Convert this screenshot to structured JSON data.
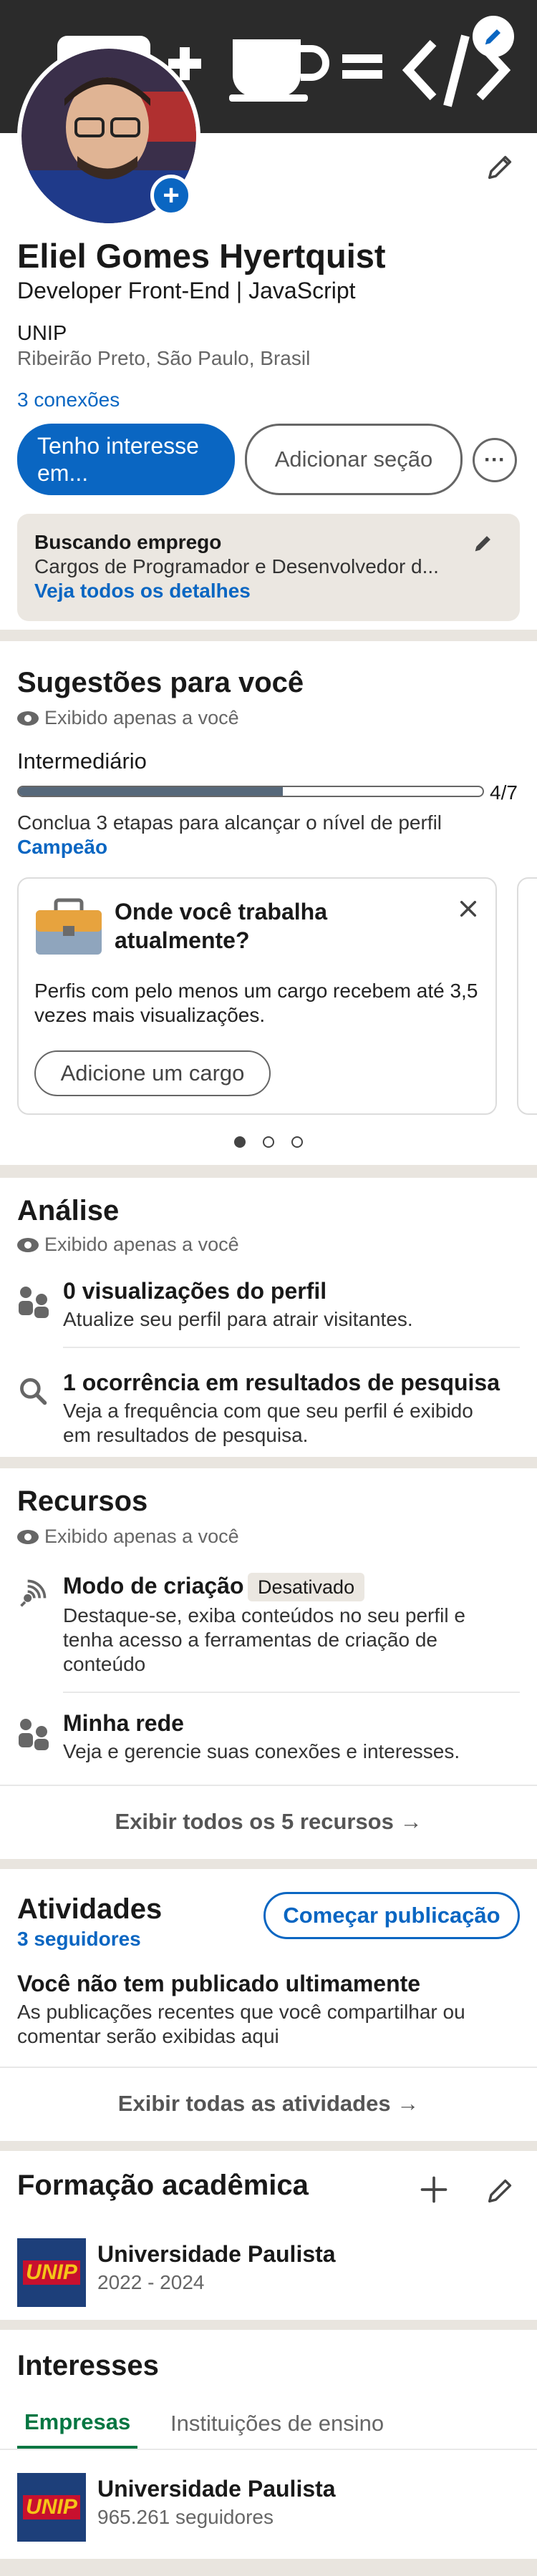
{
  "header": {
    "banner_glyphs": "☕ = </>",
    "add_photo_label": "+"
  },
  "profile": {
    "name": "Eliel Gomes Hyertquist",
    "headline": "Developer Front-End | JavaScript",
    "school": "UNIP",
    "location": "Ribeirão Preto, São Paulo, Brasil",
    "connections": "3 conexões",
    "primary_button": "Tenho interesse em...",
    "secondary_button": "Adicionar seção",
    "more_button": "···"
  },
  "open_to_work": {
    "title": "Buscando emprego",
    "description": "Cargos de Programador e Desenvolvedor d...",
    "link": "Veja todos os detalhes"
  },
  "suggestions": {
    "title": "Sugestões para você",
    "private_label": "Exibido apenas a você",
    "level": "Intermediário",
    "progress_text": "4/7",
    "progress_fraction": 0.57,
    "hint": "Conclua 3 etapas para alcançar o nível de perfil",
    "target_level": "Campeão",
    "card_title": "Onde você trabalha atualmente?",
    "card_text": "Perfis com pelo menos um cargo recebem até 3,5 vezes mais visualizações.",
    "card_button": "Adicione um cargo",
    "dots_total": 3,
    "dots_active": 0
  },
  "analytics": {
    "title": "Análise",
    "private_label": "Exibido apenas a você",
    "items": [
      {
        "title": "0 visualizações do perfil",
        "subtitle": "Atualize seu perfil para atrair visitantes."
      },
      {
        "title": "1 ocorrência em resultados de pesquisa",
        "subtitle_1": "Veja a frequência com que seu perfil é exibido",
        "subtitle_2": "em resultados de pesquisa."
      }
    ]
  },
  "resources": {
    "title": "Recursos",
    "private_label": "Exibido apenas a você",
    "creator_title": "Modo de criação",
    "creator_badge": "Desativado",
    "creator_line_1": "Destaque-se, exiba conteúdos no seu perfil e",
    "creator_line_2": "tenha acesso a ferramentas de criação de",
    "creator_line_3": "conteúdo",
    "network_title": "Minha rede",
    "network_subtitle": "Veja e gerencie suas conexões e interesses.",
    "show_all": "Exibir todos os 5 recursos →"
  },
  "activity": {
    "title": "Atividades",
    "followers": "3 seguidores",
    "start_post_button": "Começar publicação",
    "empty_title": "Você não tem publicado ultimamente",
    "empty_line_1": "As publicações recentes que você compartilhar ou",
    "empty_line_2": "comentar serão exibidas aqui",
    "show_all": "Exibir todas as atividades →"
  },
  "education": {
    "title": "Formação acadêmica",
    "school_name": "Universidade Paulista",
    "years": "2022 - 2024",
    "logo_text": "UNIP"
  },
  "interests": {
    "title": "Interesses",
    "tabs": [
      "Empresas",
      "Instituições de ensino"
    ],
    "active_tab": 0,
    "company_name": "Universidade Paulista",
    "company_followers": "965.261 seguidores",
    "logo_text": "UNIP"
  },
  "colors": {
    "brand_blue": "#0a66c2",
    "link_blue": "#0a66c2",
    "green_tab": "#057642",
    "progress_fill": "#56687a",
    "banner_dark": "#2b2b2b"
  }
}
